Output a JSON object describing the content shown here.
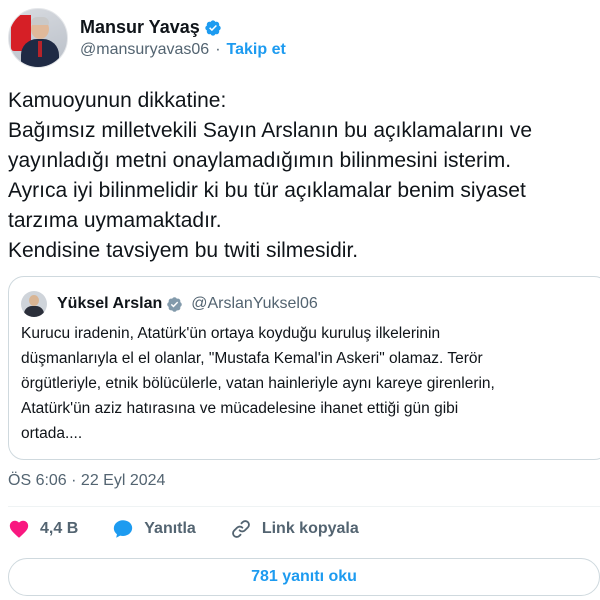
{
  "author": {
    "name": "Mansur Yavaş",
    "handle": "@mansuryavas06",
    "separator": "·",
    "follow_label": "Takip et"
  },
  "tweet": {
    "lines": [
      "Kamuoyunun dikkatine:",
      "Bağımsız milletvekili Sayın Arslanın bu açıklamalarını ve",
      "yayınladığı metni onaylamadığımın bilinmesini isterim.",
      "Ayrıca iyi bilinmelidir ki bu tür açıklamalar benim siyaset",
      "tarzıma uymamaktadır.",
      "Kendisine tavsiyem bu twiti silmesidir."
    ]
  },
  "quoted": {
    "name": "Yüksel Arslan",
    "handle": "@ArslanYuksel06",
    "lines": [
      "Kurucu iradenin, Atatürk'ün ortaya koyduğu kuruluş ilkelerinin",
      "düşmanlarıyla el el olanlar, \"Mustafa Kemal'in Askeri\" olamaz. Terör",
      "örgütleriyle, etnik bölücülerle, vatan hainleriyle aynı kareye girenlerin,",
      "Atatürk'ün aziz hatırasına ve mücadelesine ihanet ettiği gün gibi",
      "ortada...."
    ]
  },
  "timestamp": "ÖS 6:06 · 22 Eyl 2024",
  "actions": {
    "likes": "4,4 B",
    "reply_label": "Yanıtla",
    "copy_link_label": "Link kopyala"
  },
  "replies_button": "781 yanıtı oku",
  "colors": {
    "accent": "#1d9bf0",
    "like": "#f91880",
    "muted": "#536471",
    "text": "#0f1419",
    "border": "#cfd9de"
  },
  "icons": {
    "verified": "verified-badge-icon",
    "like": "heart-icon",
    "reply": "speech-bubble-icon",
    "link": "link-icon"
  }
}
